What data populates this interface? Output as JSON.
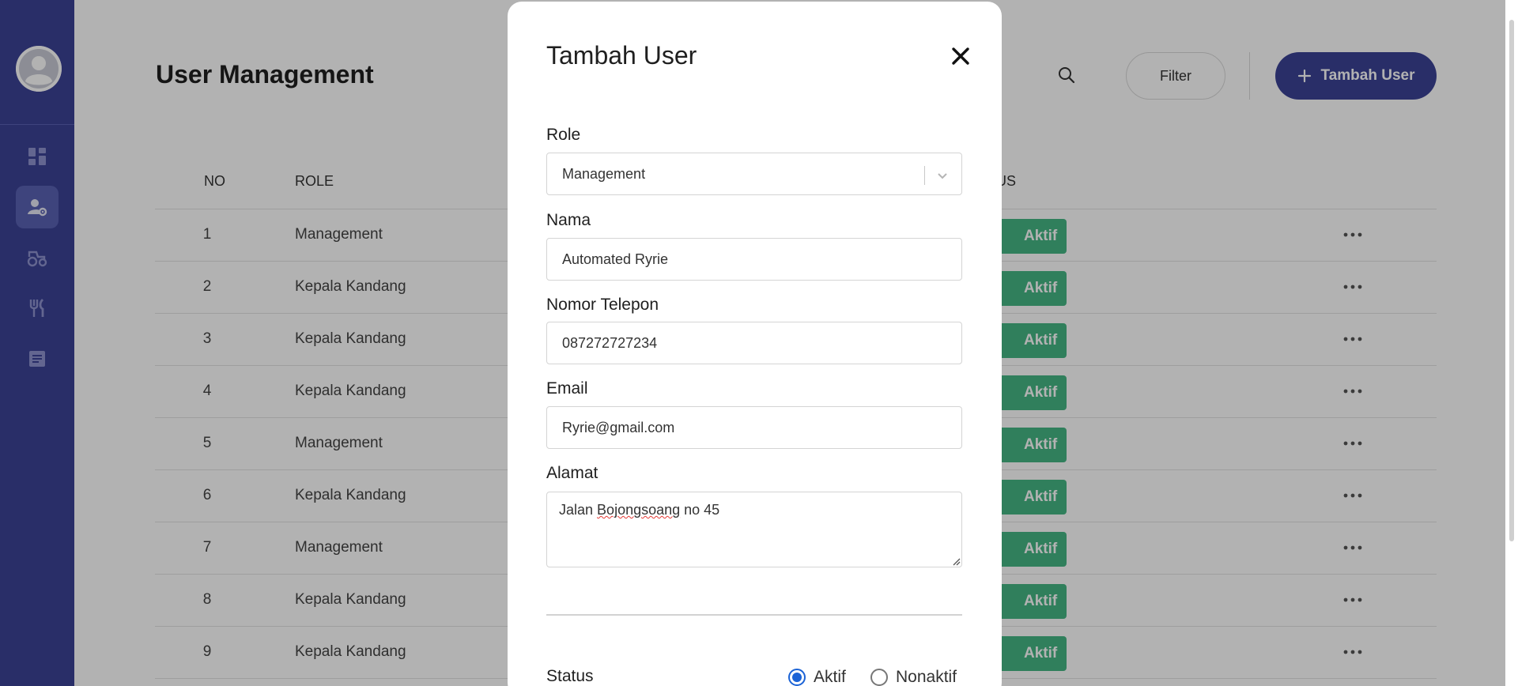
{
  "sidebar": {
    "items": [
      {
        "name": "dashboard",
        "icon": "dashboard-grid-icon",
        "active": false
      },
      {
        "name": "user-management",
        "icon": "user-gear-icon",
        "active": true
      },
      {
        "name": "tractor",
        "icon": "tractor-icon",
        "active": false
      },
      {
        "name": "feed",
        "icon": "fork-knife-icon",
        "active": false
      },
      {
        "name": "report",
        "icon": "document-icon",
        "active": false
      }
    ],
    "accent": "#3b4296",
    "active_bg": "#5a62b3"
  },
  "header": {
    "title": "User Management",
    "search_icon": "search-icon",
    "filter_label": "Filter",
    "add_label": "Tambah User"
  },
  "table": {
    "columns": {
      "no": "NO",
      "role": "ROLE",
      "status_partial": "US"
    },
    "rows": [
      {
        "no": "1",
        "role": "Management",
        "status": "Aktif"
      },
      {
        "no": "2",
        "role": "Kepala Kandang",
        "status": "Aktif"
      },
      {
        "no": "3",
        "role": "Kepala Kandang",
        "status": "Aktif"
      },
      {
        "no": "4",
        "role": "Kepala Kandang",
        "status": "Aktif"
      },
      {
        "no": "5",
        "role": "Management",
        "status": "Aktif"
      },
      {
        "no": "6",
        "role": "Kepala Kandang",
        "status": "Aktif"
      },
      {
        "no": "7",
        "role": "Management",
        "status": "Aktif"
      },
      {
        "no": "8",
        "role": "Kepala Kandang",
        "status": "Aktif"
      },
      {
        "no": "9",
        "role": "Kepala Kandang",
        "status": "Aktif"
      }
    ],
    "status_color": "#46b684"
  },
  "modal": {
    "title": "Tambah User",
    "role_label": "Role",
    "role_value": "Management",
    "nama_label": "Nama",
    "nama_value": "Automated Ryrie",
    "telepon_label": "Nomor Telepon",
    "telepon_value": "087272727234",
    "email_label": "Email",
    "email_value": "Ryrie@gmail.com",
    "alamat_label": "Alamat",
    "alamat_value_pre": "Jalan ",
    "alamat_value_misspelled": "Bojongsoang",
    "alamat_value_post": " no 45",
    "status_label": "Status",
    "status_options": [
      "Aktif",
      "Nonaktif"
    ],
    "status_selected": "Aktif"
  }
}
